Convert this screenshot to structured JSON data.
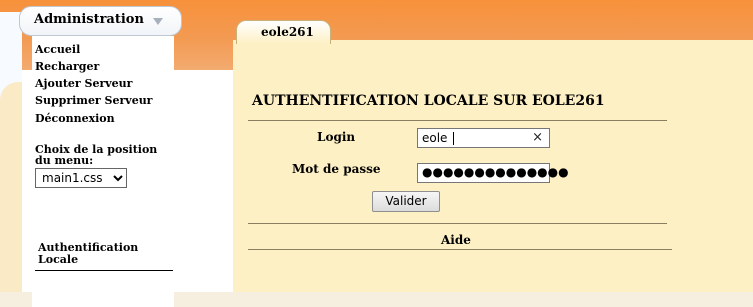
{
  "sidebar": {
    "tab_label": "Administration",
    "items": [
      {
        "label": "Accueil"
      },
      {
        "label": "Recharger"
      },
      {
        "label": "Ajouter Serveur"
      },
      {
        "label": "Supprimer Serveur"
      },
      {
        "label": "Déconnexion"
      }
    ],
    "position_label": "Choix de la position du menu:",
    "position_selected": "main1.css",
    "auth_label": "Authentification Locale"
  },
  "content": {
    "host_tab": "eole261",
    "title": "AUTHENTIFICATION LOCALE SUR EOLE261",
    "login_label": "Login",
    "login_value": "eole",
    "clear_glyph": "×",
    "password_label": "Mot de passe",
    "password_mask": "●●●●●●●●●●●●●●",
    "submit_label": "Valider",
    "help_label": "Aide"
  },
  "colors": {
    "header_orange": "#f7913b",
    "content_bg": "#fdf0c4",
    "rule": "#8a7e61"
  }
}
